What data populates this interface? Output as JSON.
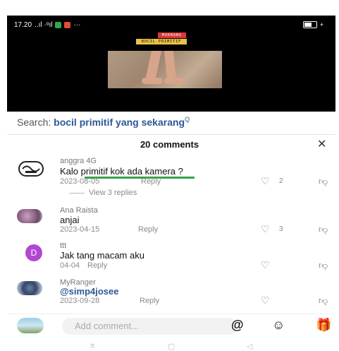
{
  "status": {
    "time": "17.20",
    "signal": "..ıl ·ᵒıl",
    "more": "···",
    "battery": "",
    "bolt": "+"
  },
  "video": {
    "tag_top": "MUKBANG",
    "tag_bottom": "BOCIL PRIMITIF"
  },
  "search": {
    "prefix": "Search: ",
    "query": "bocil primitif yang sekarang",
    "mark": "Q"
  },
  "comments_header": {
    "title": "20 comments",
    "close": "✕"
  },
  "comments": [
    {
      "user": "anggra 4G",
      "text": "Kalo primitif kok ada kamera ?",
      "date": "2023-08-05",
      "reply": "Reply",
      "likes": "2",
      "view_replies": "View 3 replies"
    },
    {
      "user": "Ana Raista",
      "text": "anjai",
      "date": "2023-04-15",
      "reply": "Reply",
      "likes": "3"
    },
    {
      "user": "ttt",
      "text": "Jak tang macam aku",
      "date": "04-04",
      "reply": "Reply",
      "likes": "",
      "avatar_letter": "D"
    },
    {
      "user": "MyRanger",
      "text": "@simp4josee",
      "date": "2023-09-28",
      "reply": "Reply",
      "likes": ""
    }
  ],
  "composer": {
    "placeholder": "Add comment...",
    "at": "@",
    "emoji": "☺",
    "gift": "🎁"
  },
  "nav": {
    "menu": "≡",
    "home": "▢",
    "back": "◁"
  },
  "colors": {
    "accent": "#2b5797",
    "avatar_d": "#b347d1"
  }
}
